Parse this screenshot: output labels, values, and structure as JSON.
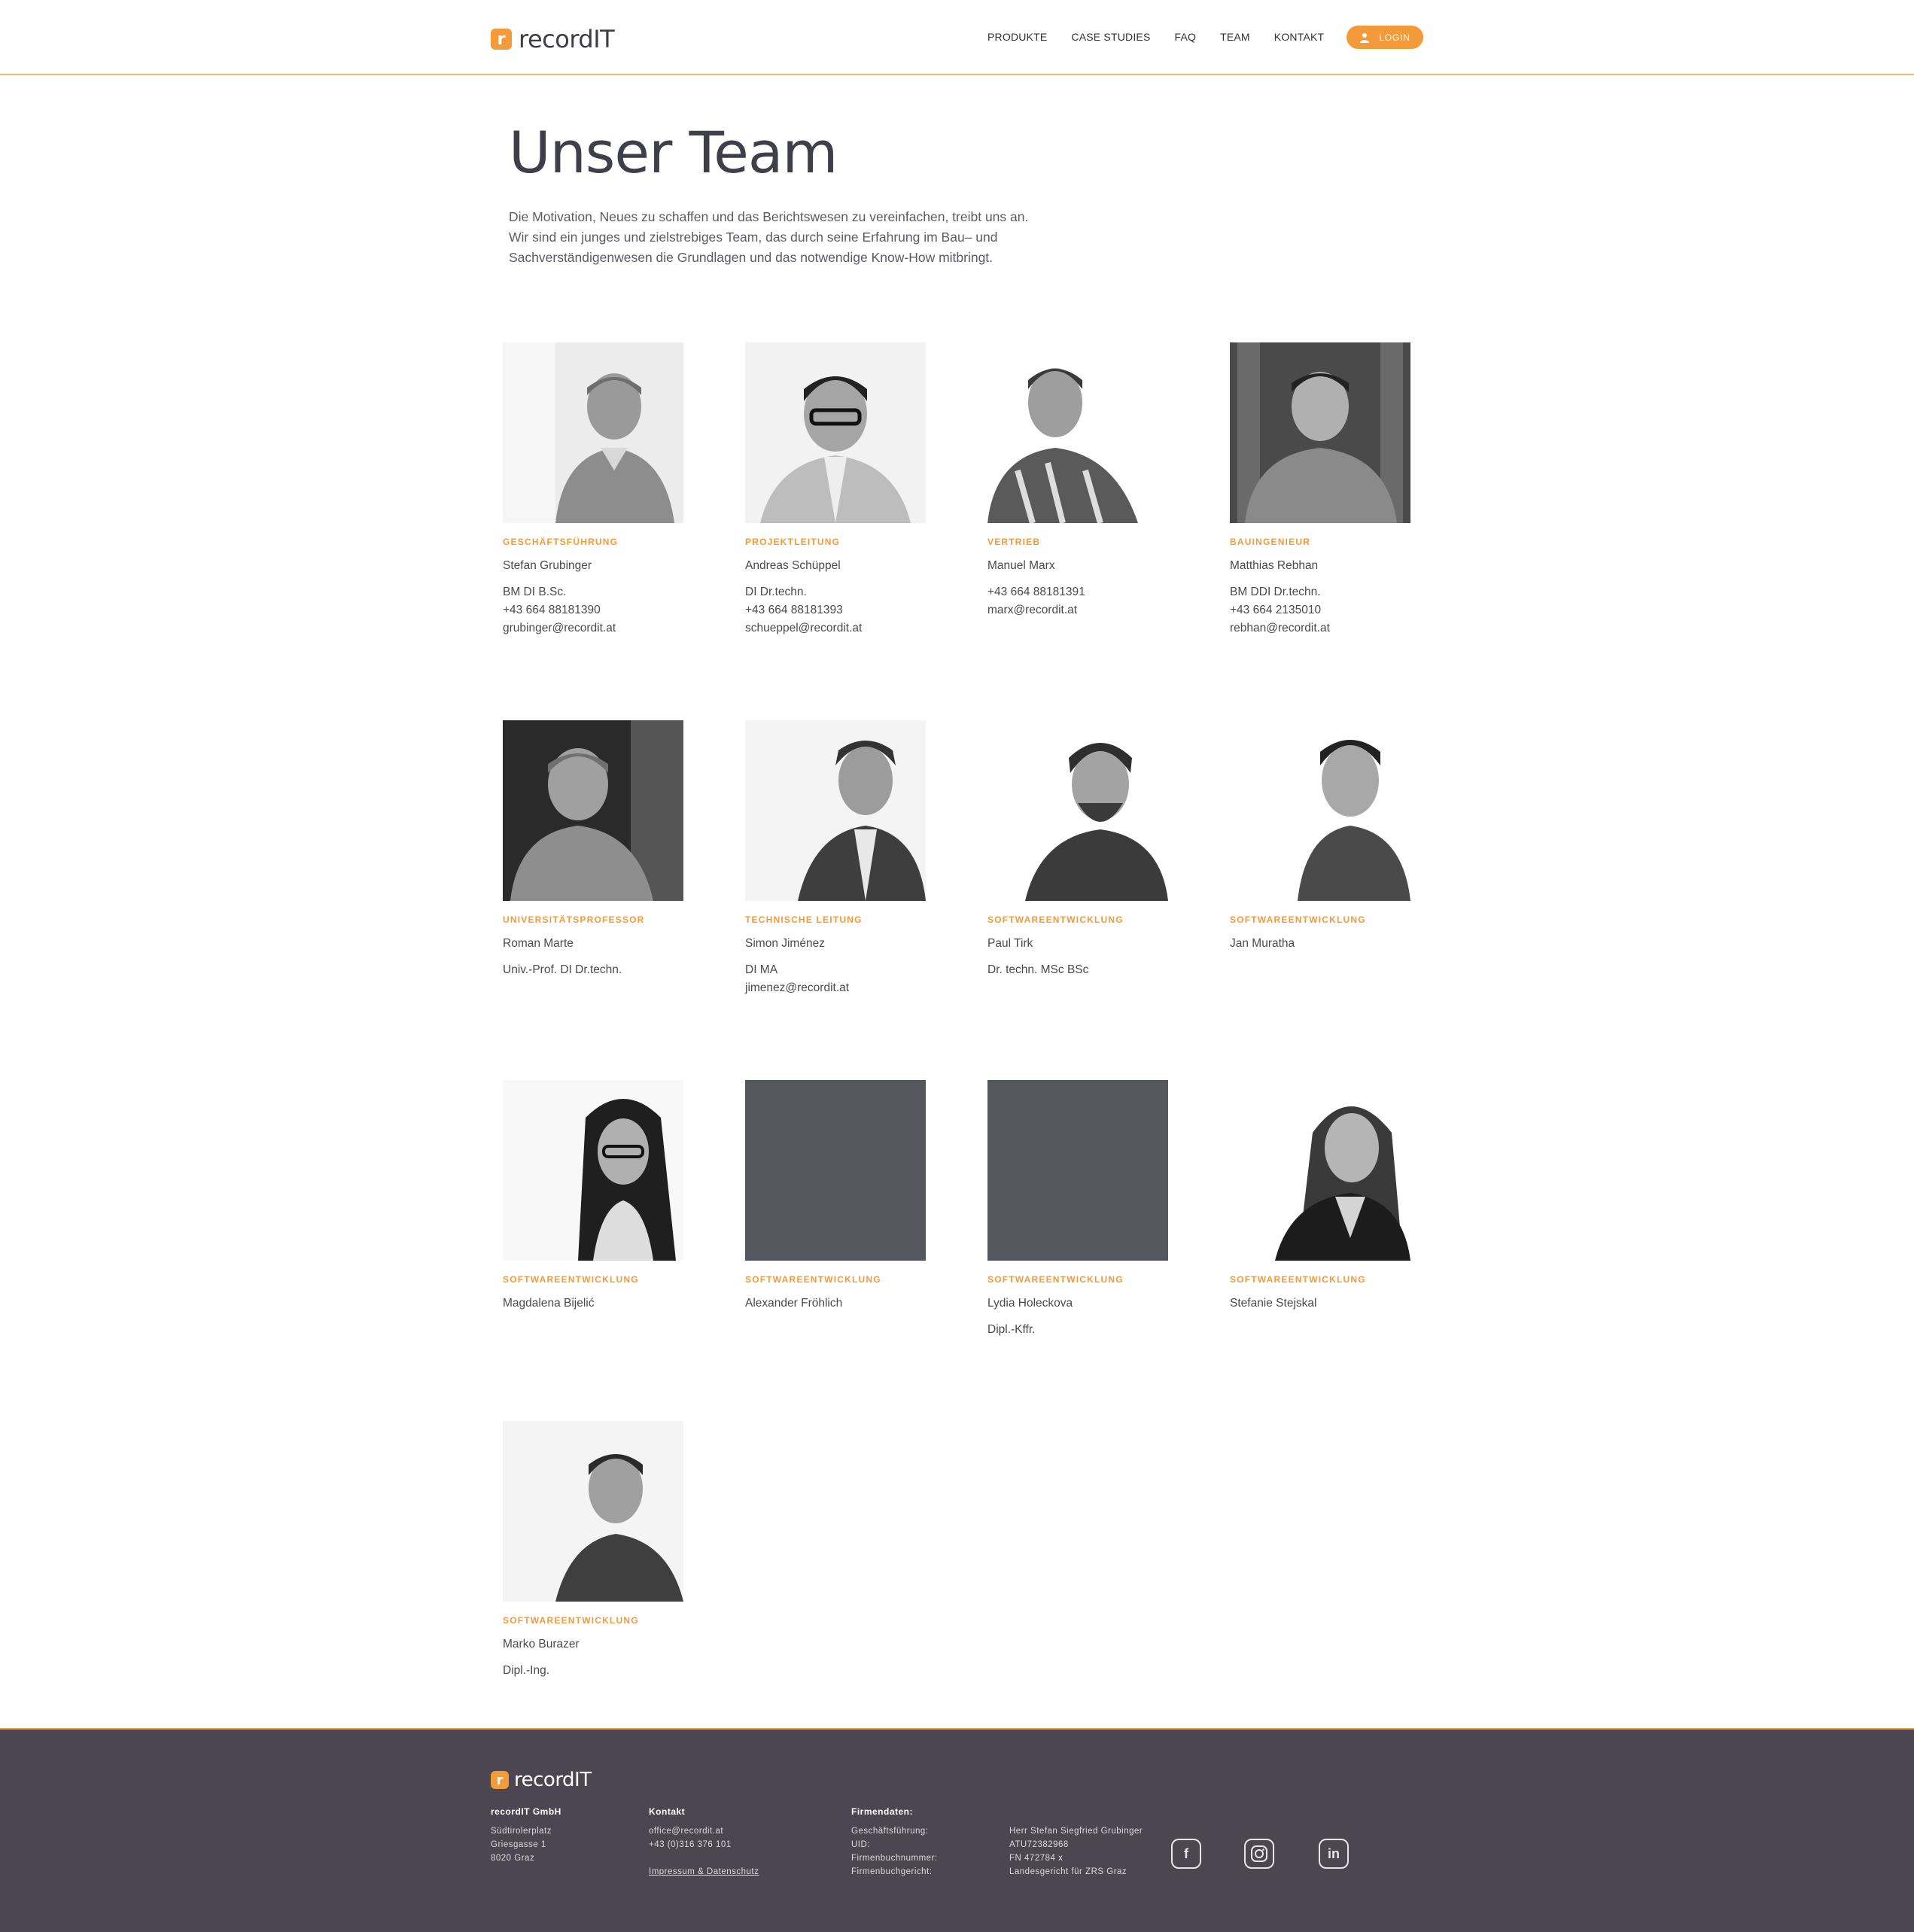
{
  "header": {
    "logo_letter": "r",
    "logo_text": "recordIT",
    "nav": [
      "PRODUKTE",
      "CASE STUDIES",
      "FAQ",
      "TEAM",
      "KONTAKT"
    ],
    "login_label": "LOGIN"
  },
  "intro": {
    "title": "Unser Team",
    "text": "Die Motivation, Neues zu schaffen und das Berichtswesen zu vereinfachen, treibt uns an. Wir sind ein junges und zielstrebiges Team, das durch seine Erfahrung im Bau– und Sachverständigenwesen die Grundlagen und das notwendige Know-How mitbringt."
  },
  "team": [
    {
      "role": "GESCHÄFTSFÜHRUNG",
      "name": "Stefan Grubinger",
      "details": [
        "BM DI B.Sc.",
        "+43 664 88181390",
        "grubinger@recordit.at"
      ]
    },
    {
      "role": "PROJEKTLEITUNG",
      "name": "Andreas Schüppel",
      "details": [
        "DI Dr.techn.",
        "+43 664 88181393",
        "schueppel@recordit.at"
      ]
    },
    {
      "role": "VERTRIEB",
      "name": "Manuel Marx",
      "details": [
        "+43 664 88181391",
        "marx@recordit.at"
      ]
    },
    {
      "role": "BAUINGENIEUR",
      "name": "Matthias Rebhan",
      "details": [
        "BM DDI Dr.techn.",
        "+43 664 2135010",
        "rebhan@recordit.at"
      ]
    },
    {
      "role": "UNIVERSITÄTSPROFESSOR",
      "name": "Roman Marte",
      "details": [
        "Univ.-Prof. DI Dr.techn."
      ]
    },
    {
      "role": "TECHNISCHE LEITUNG",
      "name": "Simon Jiménez",
      "details": [
        "DI MA",
        "jimenez@recordit.at"
      ]
    },
    {
      "role": "SOFTWAREENTWICKLUNG",
      "name": "Paul Tirk",
      "details": [
        "Dr. techn. MSc BSc"
      ]
    },
    {
      "role": "SOFTWAREENTWICKLUNG",
      "name": "Jan Muratha",
      "details": []
    },
    {
      "role": "SOFTWAREENTWICKLUNG",
      "name": "Magdalena Bijelić",
      "details": []
    },
    {
      "role": "SOFTWAREENTWICKLUNG",
      "name": "Alexander Fröhlich",
      "details": []
    },
    {
      "role": "SOFTWAREENTWICKLUNG",
      "name": "Lydia Holeckova",
      "details": [
        "Dipl.-Kffr."
      ]
    },
    {
      "role": "SOFTWAREENTWICKLUNG",
      "name": "Stefanie Stejskal",
      "details": []
    },
    {
      "role": "SOFTWAREENTWICKLUNG",
      "name": "Marko Burazer",
      "details": [
        "Dipl.-Ing."
      ]
    }
  ],
  "footer": {
    "logo_text": "recordIT",
    "company": {
      "head": "recordIT GmbH",
      "lines": [
        "Südtirolerplatz",
        "Griesgasse 1",
        "8020 Graz"
      ]
    },
    "contact": {
      "head": "Kontakt",
      "email": "office@recordit.at",
      "phone": "+43 (0)316 376 101",
      "legal_link": "Impressum & Datenschutz"
    },
    "firm": {
      "head": "Firmendaten:",
      "labels": [
        "Geschäftsführung:",
        "UID:",
        "Firmenbuchnummer:",
        "Firmenbuchgericht:"
      ],
      "values": [
        "Herr Stefan Siegfried Grubinger",
        "ATU72382968",
        "FN 472784 x",
        "Landesgericht für ZRS Graz"
      ]
    },
    "social": [
      "facebook-icon",
      "instagram-icon",
      "linkedin-icon"
    ]
  },
  "colors": {
    "accent": "#f39a3b",
    "footer_bg": "#4b4651",
    "text": "#4a4a4a"
  }
}
